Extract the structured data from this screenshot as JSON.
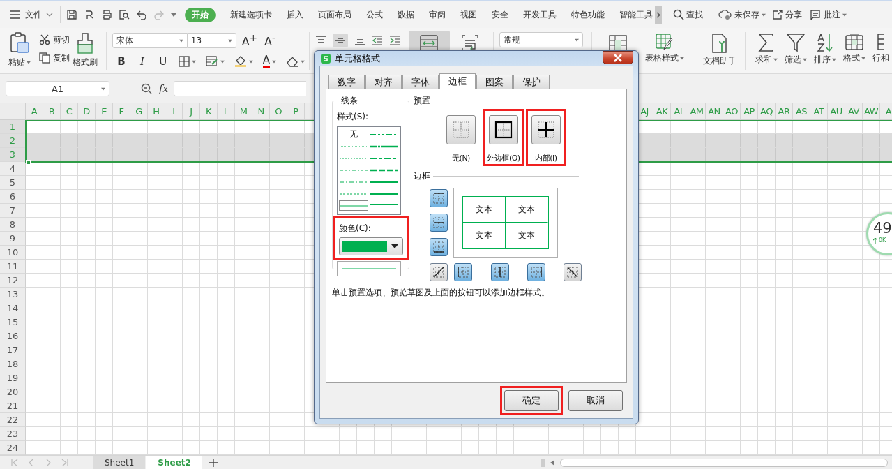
{
  "menu_bar": {
    "file_menu": "文件",
    "tabs": [
      {
        "label": "开始",
        "selected": true
      },
      {
        "label": "新建选项卡",
        "selected": false
      },
      {
        "label": "插入",
        "selected": false
      },
      {
        "label": "页面布局",
        "selected": false
      },
      {
        "label": "公式",
        "selected": false
      },
      {
        "label": "数据",
        "selected": false
      },
      {
        "label": "审阅",
        "selected": false
      },
      {
        "label": "视图",
        "selected": false
      },
      {
        "label": "安全",
        "selected": false
      },
      {
        "label": "开发工具",
        "selected": false
      },
      {
        "label": "特色功能",
        "selected": false
      },
      {
        "label": "智能工具",
        "selected": false
      }
    ],
    "search": "查找",
    "save_status": "未保存",
    "share": "分享",
    "comment": "批注"
  },
  "ribbon": {
    "paste": "粘贴",
    "cut": "剪切",
    "copy": "复制",
    "format_painter": "格式刷",
    "font_name": "宋体",
    "font_size": "13",
    "grow_font": "A$^{+}$",
    "shrink_font": "A$^{-}$",
    "format_buttons": [
      "B",
      "I",
      "U"
    ],
    "font_color": "A",
    "number_format": "常规",
    "right_buttons": [
      {
        "kind": "table-style",
        "label": "表格样式"
      },
      {
        "kind": "doc-helper",
        "label": "文档助手"
      },
      {
        "kind": "sum",
        "label": "求和"
      },
      {
        "kind": "filter",
        "label": "筛选"
      },
      {
        "kind": "sort",
        "label": "排序"
      },
      {
        "kind": "format",
        "label": "格式"
      },
      {
        "kind": "rows",
        "label": "行和"
      }
    ]
  },
  "formula_bar": {
    "cell_ref": "A1",
    "fx": "fx"
  },
  "sheet": {
    "columns_left": [
      "A",
      "B",
      "C",
      "D",
      "E",
      "F",
      "G",
      "H",
      "I",
      "J",
      "K",
      "L",
      "M",
      "N",
      "O",
      "P"
    ],
    "columns_right": [
      "AJ",
      "AK",
      "AL",
      "AM",
      "AN",
      "AO",
      "AP",
      "AQ",
      "AR",
      "AS",
      "AT",
      "AU",
      "AV",
      "AW",
      "A"
    ],
    "rows": [
      {
        "label": "1",
        "selected": true
      },
      {
        "label": "2",
        "selected": true
      },
      {
        "label": "3",
        "selected": true
      },
      {
        "label": "4",
        "selected": false
      },
      {
        "label": "5",
        "selected": false
      },
      {
        "label": "6",
        "selected": false
      },
      {
        "label": "7",
        "selected": false
      },
      {
        "label": "8",
        "selected": false
      },
      {
        "label": "9",
        "selected": false
      },
      {
        "label": "10",
        "selected": false
      },
      {
        "label": "11",
        "selected": false
      },
      {
        "label": "12",
        "selected": false
      },
      {
        "label": "13",
        "selected": false
      },
      {
        "label": "14",
        "selected": false
      },
      {
        "label": "15",
        "selected": false
      },
      {
        "label": "16",
        "selected": false
      },
      {
        "label": "17",
        "selected": false
      },
      {
        "label": "18",
        "selected": false
      },
      {
        "label": "19",
        "selected": false
      },
      {
        "label": "20",
        "selected": false
      },
      {
        "label": "21",
        "selected": false
      },
      {
        "label": "22",
        "selected": false
      },
      {
        "label": "23",
        "selected": false
      },
      {
        "label": "24",
        "selected": false
      }
    ]
  },
  "sheet_tabs": [
    {
      "label": "Sheet1",
      "selected": false
    },
    {
      "label": "Sheet2",
      "selected": true
    }
  ],
  "speed_widget": {
    "value": "49",
    "rate": "0K"
  },
  "dialog": {
    "title": "单元格格式",
    "tabs": [
      {
        "label": "数字",
        "selected": false
      },
      {
        "label": "对齐",
        "selected": false
      },
      {
        "label": "字体",
        "selected": false
      },
      {
        "label": "边框",
        "selected": true
      },
      {
        "label": "图案",
        "selected": false
      },
      {
        "label": "保护",
        "selected": false
      }
    ],
    "line_group": {
      "title": "线条",
      "style_label": "样式(S):",
      "styles": [
        {
          "kind": "none",
          "label": "无",
          "selected": false
        },
        {
          "kind": "med-dash-dot-dot",
          "selected": false
        },
        {
          "kind": "hair",
          "selected": false
        },
        {
          "kind": "slant-dash-dot",
          "selected": false
        },
        {
          "kind": "dotted",
          "selected": false
        },
        {
          "kind": "med-dash-dot",
          "selected": false
        },
        {
          "kind": "dash-dot-dot",
          "selected": false
        },
        {
          "kind": "med-dashed",
          "selected": false
        },
        {
          "kind": "dash-dot",
          "selected": false
        },
        {
          "kind": "medium",
          "selected": false
        },
        {
          "kind": "dashed",
          "selected": false
        },
        {
          "kind": "thick",
          "selected": false
        },
        {
          "kind": "thin",
          "selected": true
        },
        {
          "kind": "double",
          "selected": false
        }
      ],
      "color_label": "颜色(C):",
      "color": "#00b050",
      "highlighted": true
    },
    "presets_label": "预置",
    "presets": [
      {
        "kind": "none",
        "label": "无(N)",
        "highlighted": false
      },
      {
        "kind": "outline",
        "label": "外边框(O)",
        "highlighted": true
      },
      {
        "kind": "inside",
        "label": "内部(I)",
        "highlighted": true
      }
    ],
    "border_label": "边框",
    "border_buttons": [
      {
        "kind": "top",
        "on": true
      },
      {
        "kind": "middle",
        "on": true
      },
      {
        "kind": "bottom",
        "on": true
      },
      {
        "kind": "diag-up",
        "on": false
      },
      {
        "kind": "left",
        "on": true
      },
      {
        "kind": "center",
        "on": true
      },
      {
        "kind": "right",
        "on": true
      },
      {
        "kind": "diag-down",
        "on": false
      }
    ],
    "preview_texts": [
      "文本",
      "文本",
      "文本",
      "文本"
    ],
    "hint": "单击预置选项、预览草图及上面的按钮可以添加边框样式。",
    "buttons": [
      {
        "label": "确定",
        "highlighted": true
      },
      {
        "label": "取消",
        "highlighted": false
      }
    ]
  }
}
